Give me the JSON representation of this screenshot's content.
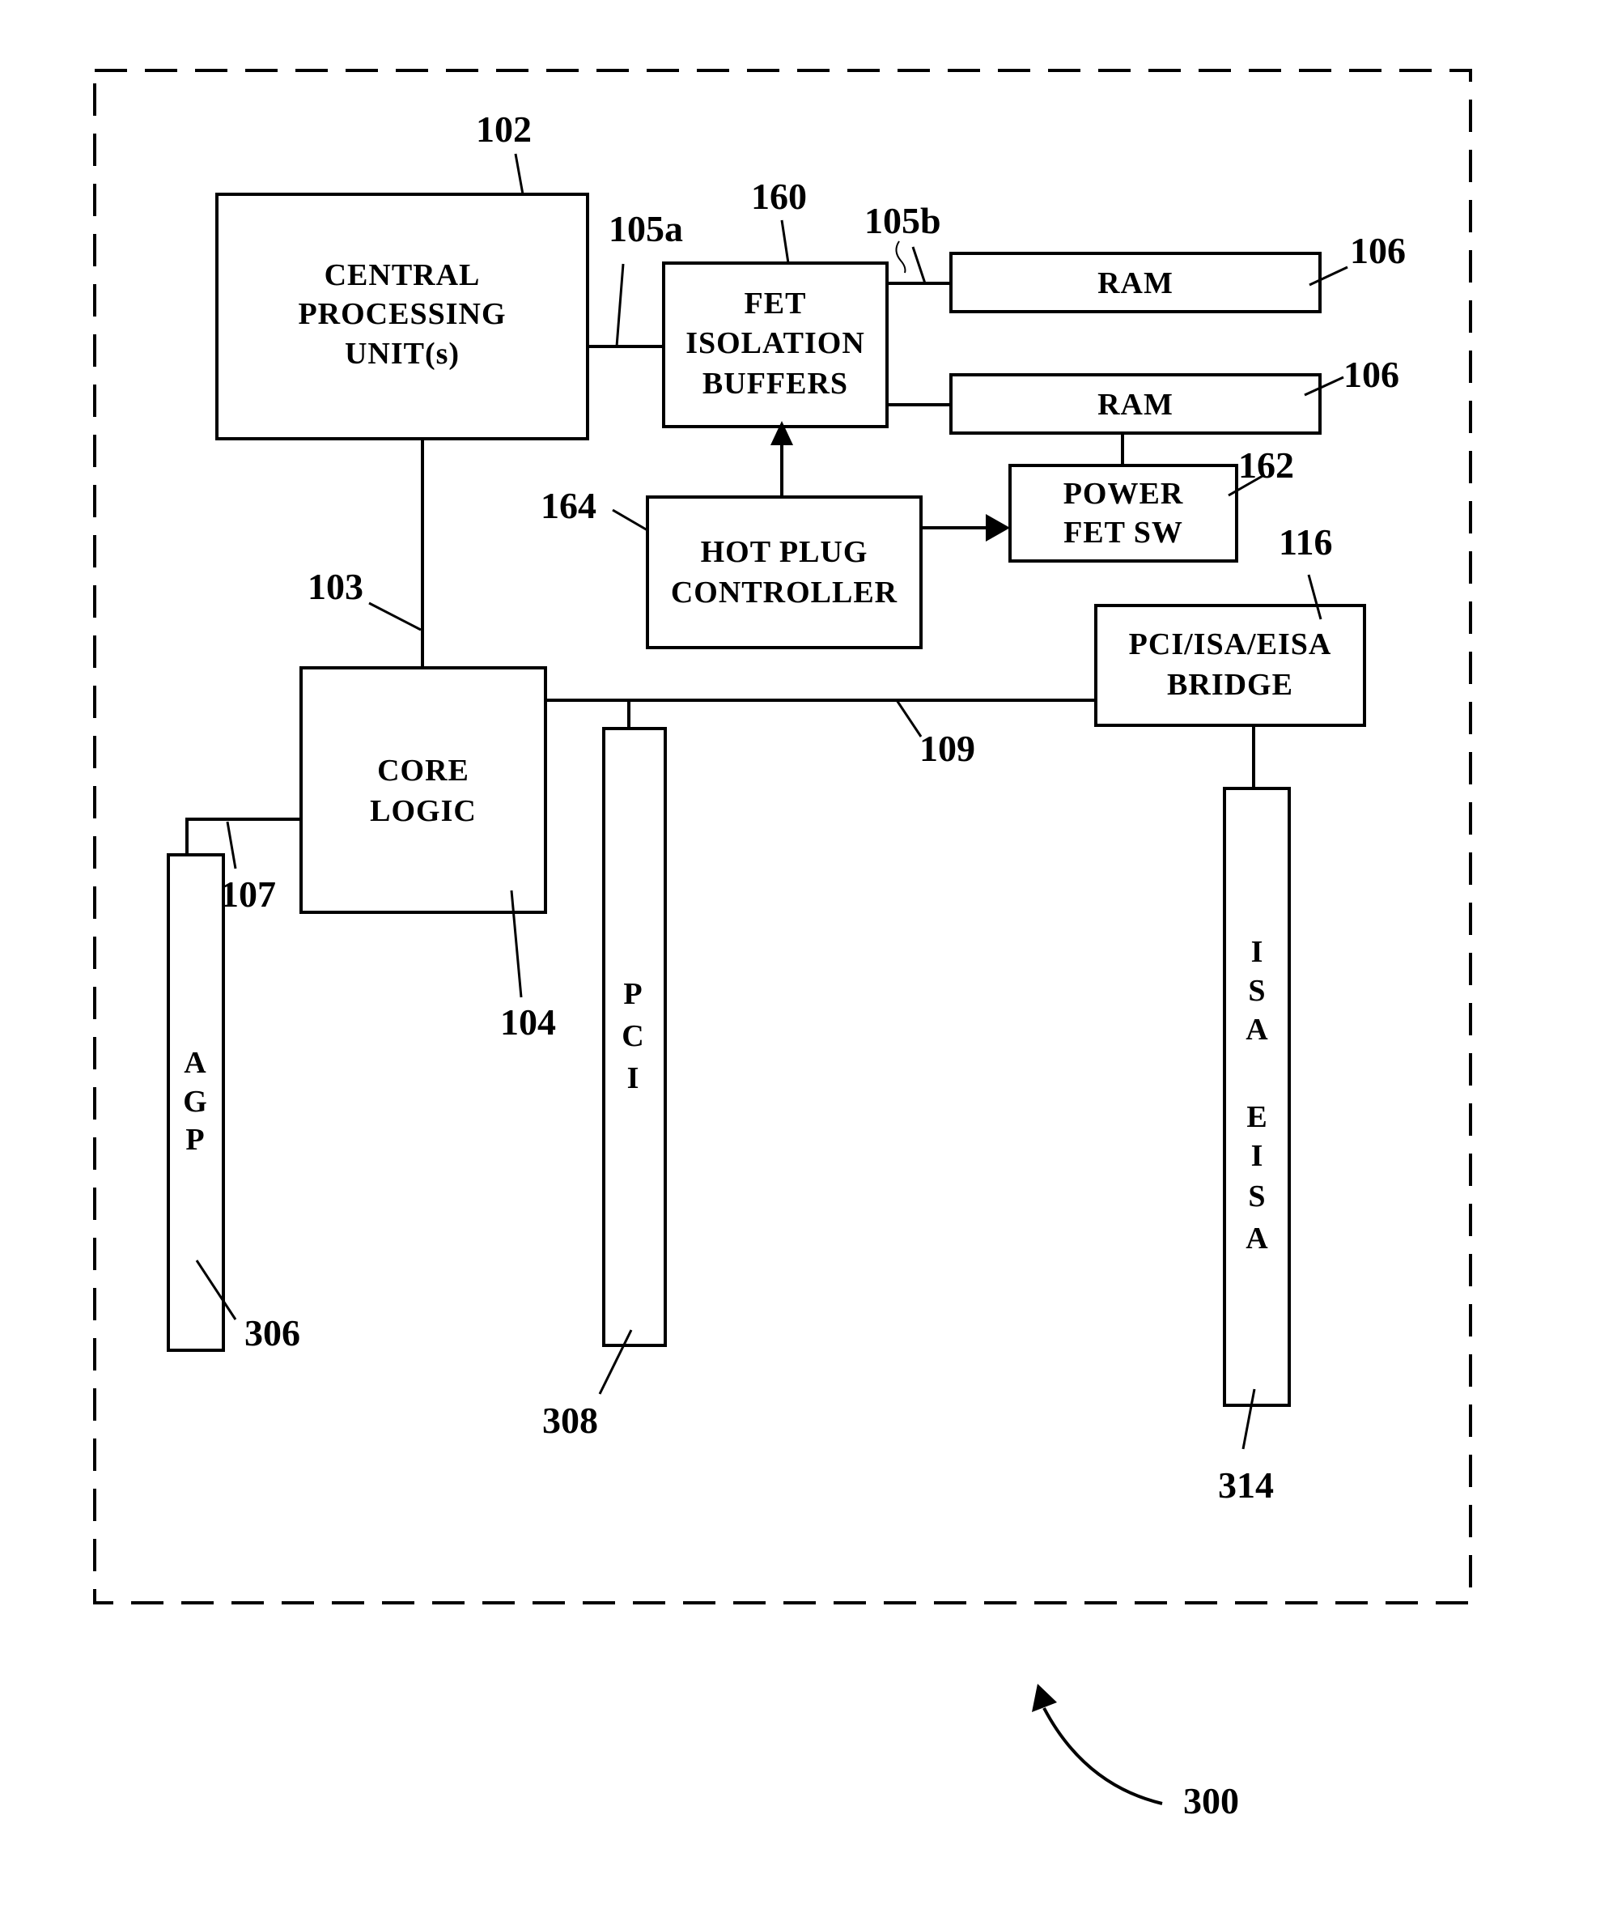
{
  "figure": {
    "reference": "300",
    "blocks": {
      "cpu": {
        "ref": "102",
        "lines": [
          "CENTRAL",
          "PROCESSING",
          "UNIT(s)"
        ]
      },
      "fet_buffers": {
        "ref": "160",
        "lines": [
          "FET",
          "ISOLATION",
          "BUFFERS"
        ]
      },
      "ram1": {
        "ref": "106",
        "lines": [
          "RAM"
        ]
      },
      "ram2": {
        "ref": "106",
        "lines": [
          "RAM"
        ]
      },
      "power_fet": {
        "ref": "162",
        "lines": [
          "POWER",
          "FET SW"
        ]
      },
      "hot_plug": {
        "ref": "164",
        "lines": [
          "HOT PLUG",
          "CONTROLLER"
        ]
      },
      "bridge": {
        "ref": "116",
        "lines": [
          "PCI/ISA/EISA",
          "BRIDGE"
        ]
      },
      "core_logic": {
        "ref": "104",
        "lines": [
          "CORE",
          "LOGIC"
        ]
      },
      "agp_slot": {
        "ref": "306",
        "letters": [
          "A",
          "G",
          "P"
        ]
      },
      "pci_slot": {
        "ref": "308",
        "letters": [
          "P",
          "C",
          "I"
        ]
      },
      "isa_slot": {
        "ref": "314",
        "letters": [
          "I",
          "S",
          "A",
          "",
          "E",
          "I",
          "S",
          "A"
        ]
      }
    },
    "buses": {
      "host_bus_a": "105a",
      "host_bus_b": "105b",
      "cpu_core_bus": "103",
      "agp_bus": "107",
      "pci_bus": "109"
    }
  }
}
